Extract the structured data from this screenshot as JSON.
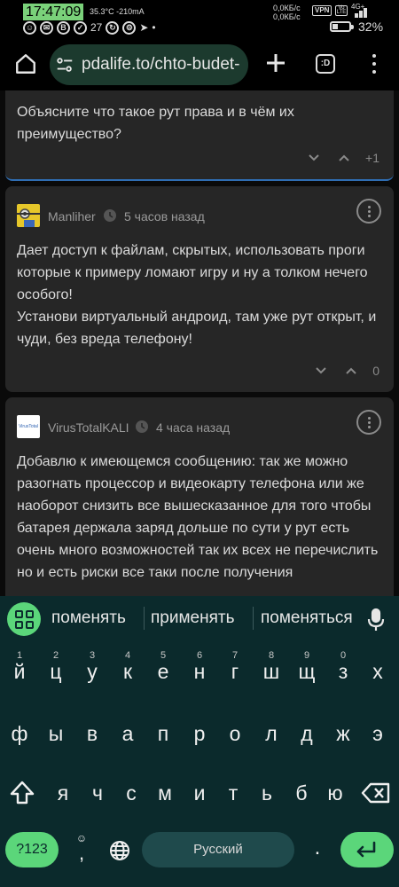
{
  "status_bar": {
    "time": "17:47:09",
    "temp_current": "35.3°C -210mA",
    "notif_count": "27",
    "net_speed_up": "0,0КБ/с",
    "net_speed_down": "0,0КБ/с",
    "vpn_label": "VPN",
    "volte_label": "Vo LTE",
    "network_type": "4G+",
    "battery_percent": "32%",
    "battery_level": 0.32
  },
  "browser": {
    "url": "pdalife.to/chto-budet-",
    "tabs_label": ":D"
  },
  "comments": [
    {
      "text": "Объясните что такое рут права и в чём их преимущество?",
      "vote_count": "+1"
    },
    {
      "author": "Manliher",
      "time_ago": "5 часов назад",
      "text_lines": [
        "Дает доступ к файлам, скрытых, использовать проги которые к примеру ломают игру и ну а толком нечего особого!",
        "Установи виртуальный андроид, там уже рут открыт, и чуди, без вреда телефону!"
      ],
      "vote_count": "0"
    },
    {
      "author": "VirusTotalKALI",
      "avatar_text": "VirusTotal",
      "time_ago": "4 часа назад",
      "text": "Добавлю к имеющемся сообщению: так же можно разогнать процессор и видеокарту телефона или же наоборот снизить все вышесказанное для того чтобы батарея держала заряд дольше по сути у рут есть очень много возможностей так их всех не перечислить но и есть риски все таки после получения"
    }
  ],
  "keyboard": {
    "suggestions": [
      "поменять",
      "применять",
      "поменяться"
    ],
    "row1": [
      {
        "key": "й",
        "hint": "1"
      },
      {
        "key": "ц",
        "hint": "2"
      },
      {
        "key": "у",
        "hint": "3"
      },
      {
        "key": "к",
        "hint": "4"
      },
      {
        "key": "е",
        "hint": "5"
      },
      {
        "key": "н",
        "hint": "6"
      },
      {
        "key": "г",
        "hint": "7"
      },
      {
        "key": "ш",
        "hint": "8"
      },
      {
        "key": "щ",
        "hint": "9"
      },
      {
        "key": "з",
        "hint": "0"
      },
      {
        "key": "х",
        "hint": ""
      }
    ],
    "row2": [
      "ф",
      "ы",
      "в",
      "а",
      "п",
      "р",
      "о",
      "л",
      "д",
      "ж",
      "э"
    ],
    "row3": [
      "я",
      "ч",
      "с",
      "м",
      "и",
      "т",
      "ь",
      "б",
      "ю"
    ],
    "symbols_label": "?123",
    "emoji_top": "☺",
    "emoji_bottom": ",",
    "space_label": "Русский",
    "period_label": "."
  },
  "colors": {
    "accent_green": "#5bd67a",
    "keyboard_bg": "#0b2a2c",
    "url_pill": "#1c3a2e",
    "card_bg": "#262626",
    "focus_border": "#2f6db2"
  },
  "icons": {
    "home": "home-icon",
    "tune": "tune-icon",
    "plus": "plus-icon",
    "more": "more-vert-icon",
    "clock": "clock-icon",
    "chevron_down": "chevron-down-icon",
    "chevron_up": "chevron-up-icon",
    "mic": "mic-icon",
    "shift": "shift-icon",
    "backspace": "backspace-icon",
    "globe": "globe-icon",
    "enter": "enter-icon"
  }
}
